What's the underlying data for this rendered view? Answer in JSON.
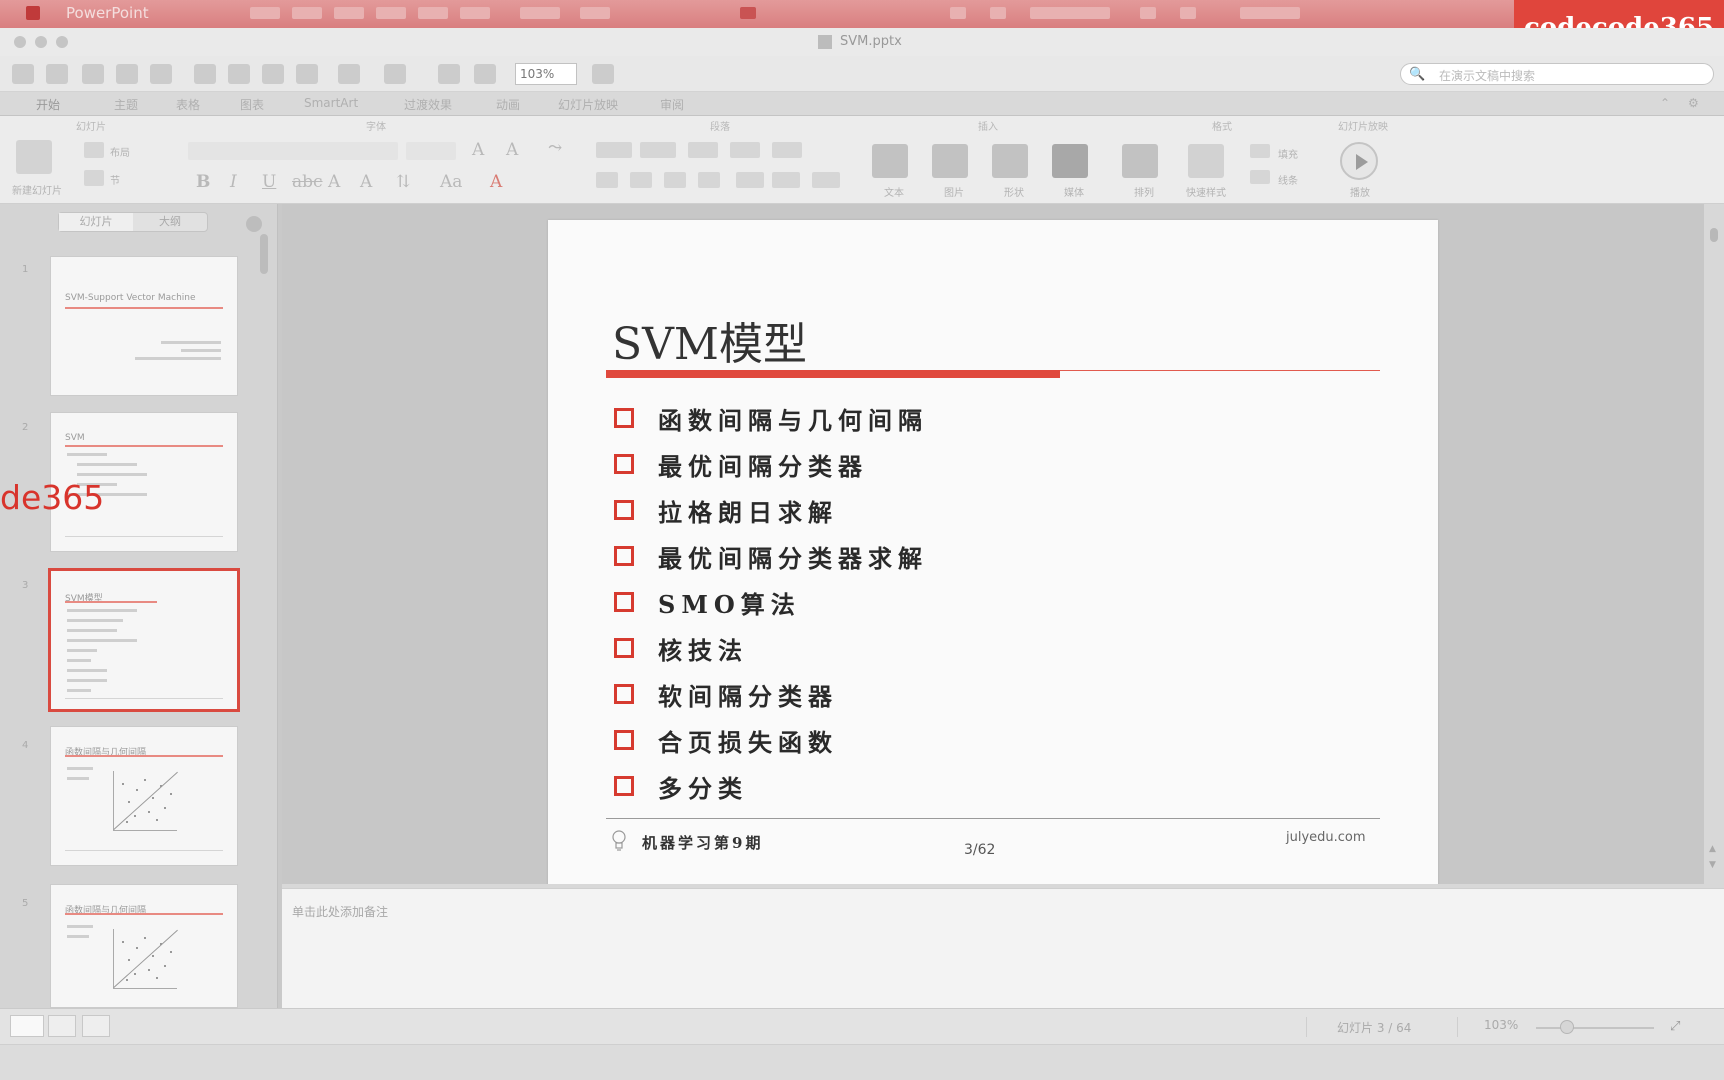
{
  "app": {
    "name": "PowerPoint",
    "window_title": "SVM.pptx",
    "watermark": "codecode365",
    "side_watermark": "de365"
  },
  "toolbar": {
    "zoom_value": "103%",
    "search_placeholder": "在演示文稿中搜索"
  },
  "ribbon_tabs": [
    "开始",
    "主题",
    "表格",
    "图表",
    "SmartArt",
    "过渡效果",
    "动画",
    "幻灯片放映",
    "审阅"
  ],
  "ribbon_groups": {
    "slides": "幻灯片",
    "font": "字体",
    "paragraph": "段落",
    "insert": "插入",
    "format": "格式",
    "slideshow": "幻灯片放映",
    "new_slide": "新建幻灯片",
    "layout": "布局",
    "section": "节",
    "text": "文本",
    "picture": "图片",
    "shape": "形状",
    "media": "媒体",
    "arrange": "排列",
    "quick_styles": "快速样式",
    "fill": "填充",
    "line": "线条",
    "play": "播放"
  },
  "side_pane": {
    "tab_slides": "幻灯片",
    "tab_outline": "大纲",
    "thumbnails": [
      {
        "num": "1",
        "title": "SVM-Support Vector Machine",
        "kind": "title"
      },
      {
        "num": "2",
        "title": "SVM",
        "kind": "bullets"
      },
      {
        "num": "3",
        "title": "SVM模型",
        "kind": "bullets",
        "selected": true
      },
      {
        "num": "4",
        "title": "函数间隔与几何间隔",
        "kind": "plot"
      },
      {
        "num": "5",
        "title": "函数间隔与几何间隔",
        "kind": "plot"
      }
    ]
  },
  "slide": {
    "title": "SVM模型",
    "bullets": [
      "函数间隔与几何间隔",
      "最优间隔分类器",
      "拉格朗日求解",
      "最优间隔分类器求解",
      "SMO算法",
      "核技法",
      "软间隔分类器",
      "合页损失函数",
      "多分类"
    ],
    "footer_course": "机器学习第9期",
    "footer_page": "3/62",
    "footer_url": "julyedu.com",
    "accent_color": "#e0493d"
  },
  "notes": {
    "placeholder": "单击此处添加备注"
  },
  "status": {
    "slide_position": "幻灯片 3 / 64",
    "zoom": "103%"
  }
}
